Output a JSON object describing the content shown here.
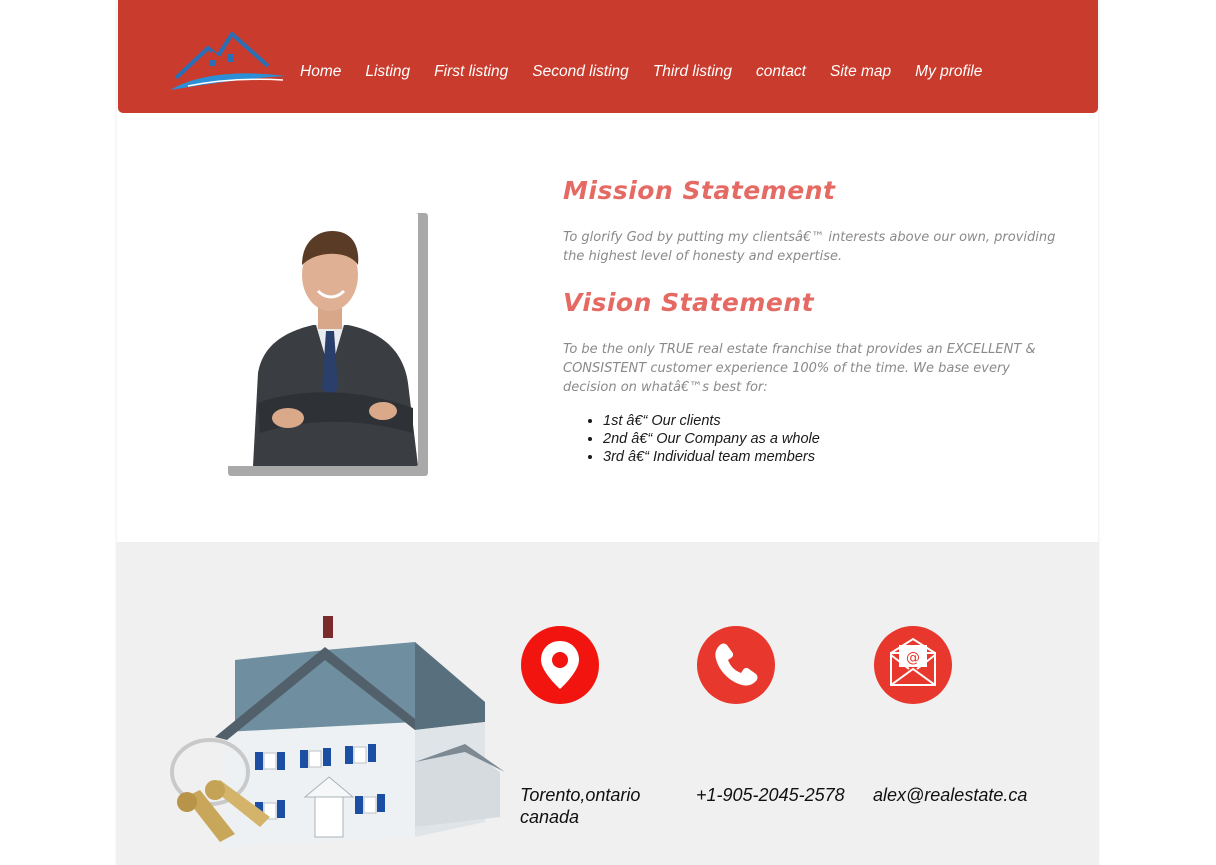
{
  "nav": {
    "items": [
      "Home",
      "Listing",
      "First listing",
      "Second listing",
      "Third listing",
      "contact",
      "Site map",
      "My profile"
    ]
  },
  "mission": {
    "title": "Mission Statement",
    "text": "To glorify God by putting my clientsâ€™ interests above our own, providing the highest level of honesty and expertise."
  },
  "vision": {
    "title": "Vision Statement",
    "text": "To be the only TRUE real estate franchise that provides an EXCELLENT & CONSISTENT customer experience 100% of the time. We base every decision on whatâ€™s best for:",
    "items": [
      "1st â€“ Our clients",
      "2nd â€“ Our Company as a whole",
      "3rd â€“ Individual team members"
    ]
  },
  "contact": {
    "address_line1": "Torento,ontario",
    "address_line2": "canada",
    "phone": "+1-905-2045-2578",
    "email": "alex@realestate.ca"
  },
  "colors": {
    "header": "#c93b2d",
    "accent_title": "#e46a63",
    "icon_red": "#e8372c"
  },
  "icons": [
    "location-pin-icon",
    "phone-icon",
    "email-envelope-icon"
  ]
}
